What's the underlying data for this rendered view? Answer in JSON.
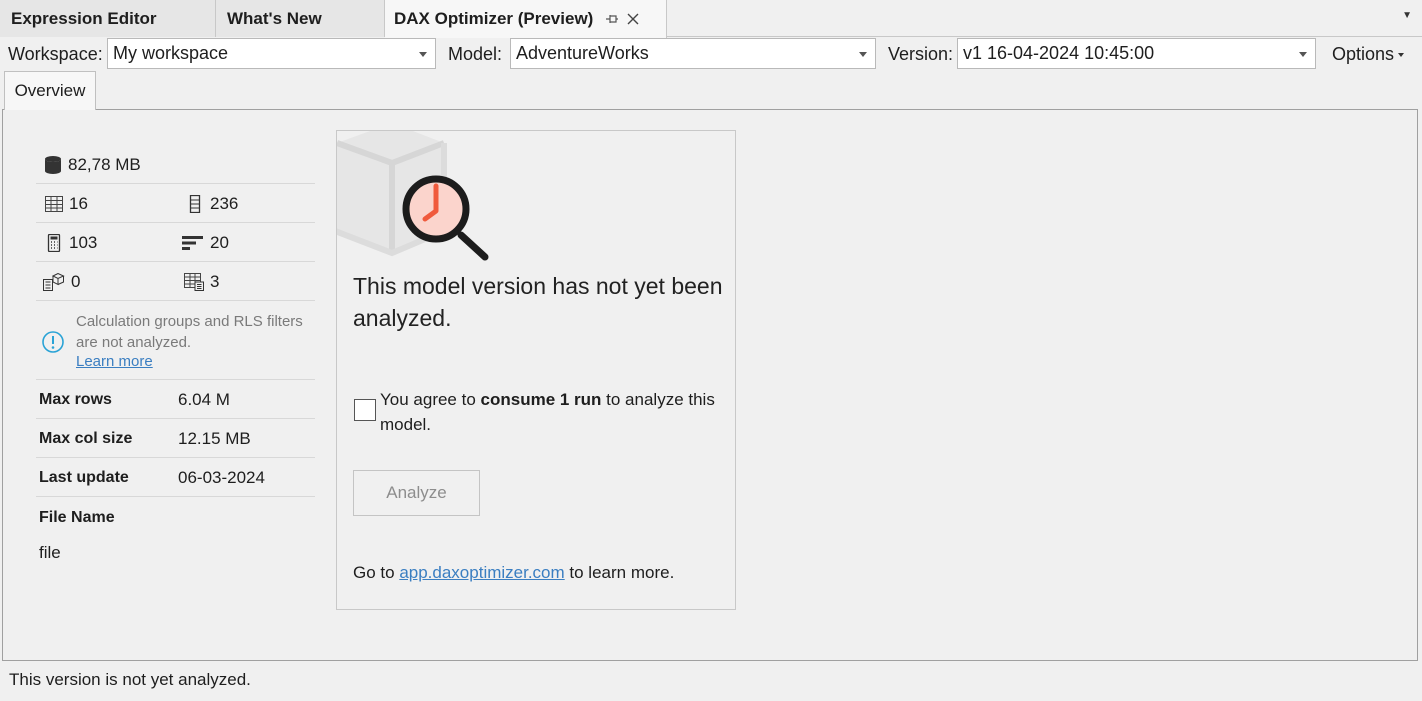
{
  "doc_tabs": [
    {
      "label": "Expression Editor"
    },
    {
      "label": "What's New"
    },
    {
      "label": "DAX Optimizer (Preview)"
    }
  ],
  "toolbar": {
    "workspace_label": "Workspace:",
    "workspace_value": "My workspace",
    "model_label": "Model:",
    "model_value": "AdventureWorks",
    "version_label": "Version:",
    "version_value": "v1 16-04-2024 10:45:00",
    "options_label": "Options"
  },
  "inner_tab": {
    "label": "Overview"
  },
  "stats": {
    "size": "82,78 MB",
    "tables": "16",
    "columns": "236",
    "measures": "103",
    "relationships": "20",
    "calc_items": "0",
    "calc_tables": "3",
    "note_text": "Calculation groups and RLS filters are not analyzed.",
    "note_link": "Learn more",
    "max_rows_label": "Max rows",
    "max_rows_value": "6.04 M",
    "max_col_label": "Max col size",
    "max_col_value": "12.15 MB",
    "last_update_label": "Last update",
    "last_update_value": "06-03-2024",
    "file_name_label": "File Name",
    "file_name_value": "file"
  },
  "card": {
    "title": "This model version has not yet been analyzed.",
    "agree_prefix": "You agree to ",
    "agree_bold": "consume 1 run",
    "agree_suffix": " to analyze this model.",
    "analyze_label": "Analyze",
    "goto_prefix": "Go to ",
    "goto_link": "app.daxoptimizer.com",
    "goto_suffix": " to learn more."
  },
  "status": {
    "text": "This version is not yet analyzed."
  },
  "colors": {
    "accent_red": "#f05a3c",
    "link": "#3a7ec1",
    "info": "#2aa3d6"
  }
}
